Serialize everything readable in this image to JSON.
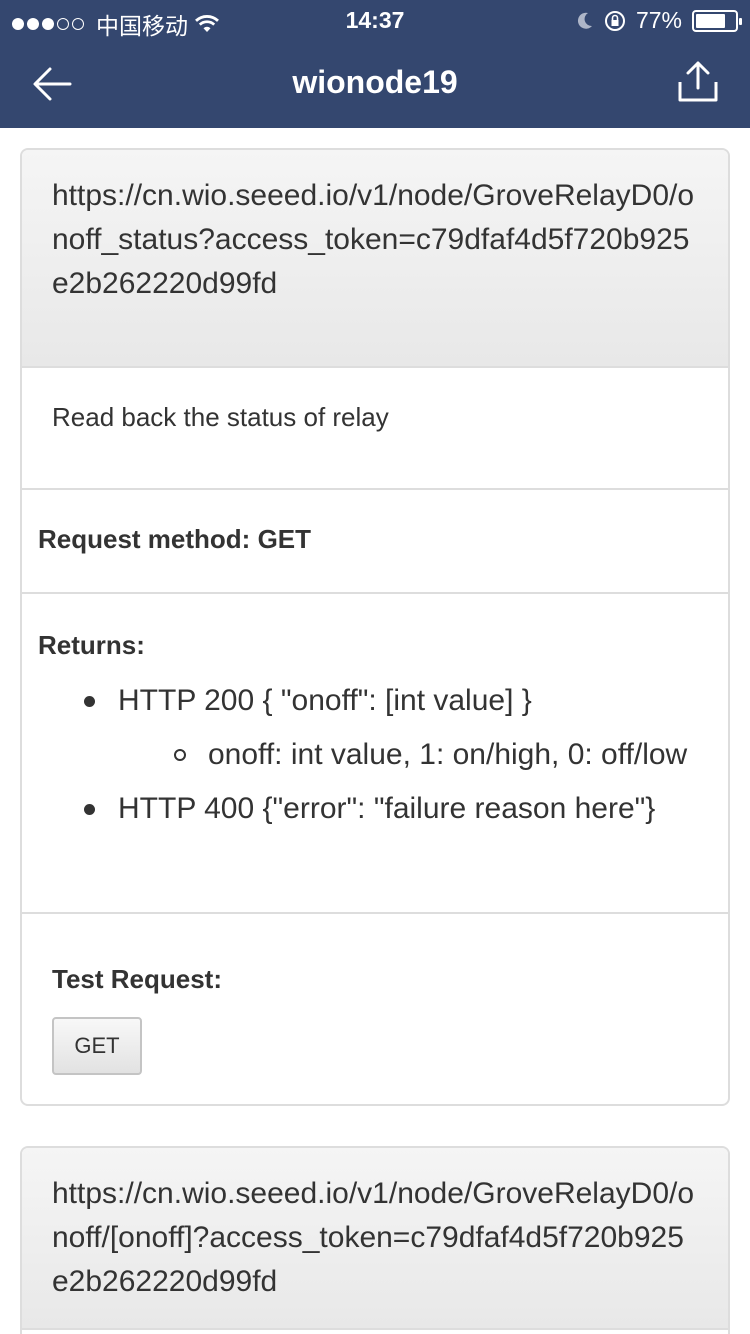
{
  "status_bar": {
    "carrier": "中国移动",
    "time": "14:37",
    "battery_percent": "77%",
    "battery_level": 0.77
  },
  "nav": {
    "title": "wionode19",
    "back_icon": "arrow-left-icon",
    "share_icon": "share-upload-icon"
  },
  "endpoints": [
    {
      "url": "https://cn.wio.seeed.io/v1/node/GroveRelayD0/onoff_status?access_token=c79dfaf4d5f720b925e2b262220d99fd",
      "description": "Read back the status of relay",
      "method_label": "Request method: GET",
      "returns_label": "Returns:",
      "returns": [
        {
          "text": "HTTP 200 { \"onoff\": [int value] }",
          "sub": [
            "onoff: int value, 1: on/high, 0: off/low"
          ]
        },
        {
          "text": "HTTP 400 {\"error\": \"failure reason here\"}",
          "sub": []
        }
      ],
      "test_label": "Test Request:",
      "button_label": "GET"
    },
    {
      "url": "https://cn.wio.seeed.io/v1/node/GroveRelayD0/onoff/[onoff]?access_token=c79dfaf4d5f720b925e2b262220d99fd"
    }
  ],
  "colors": {
    "nav_background": "#34476f",
    "card_border": "#dddddd",
    "text": "#333333"
  }
}
